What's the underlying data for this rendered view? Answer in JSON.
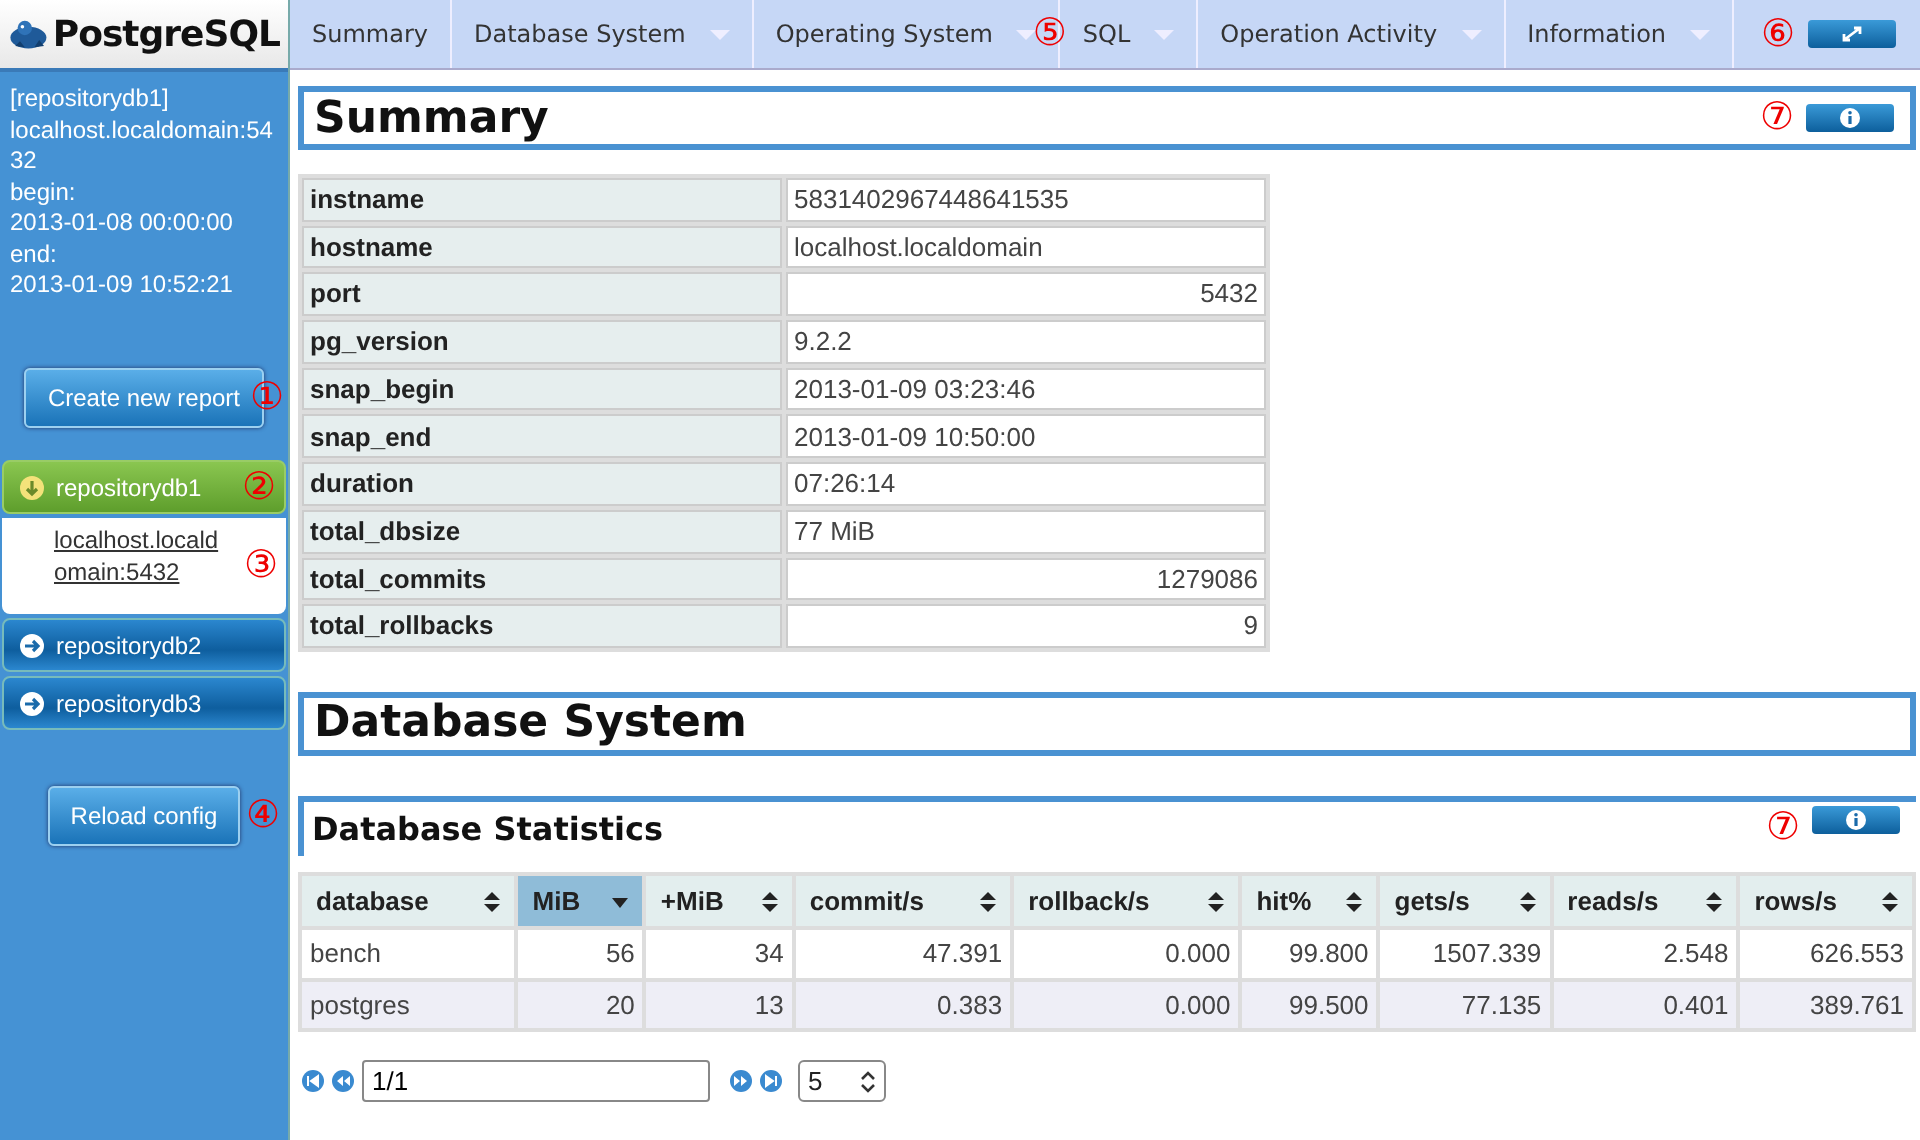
{
  "logo": {
    "text": "PostgreSQL"
  },
  "sidebar": {
    "info_lines": [
      "[repositorydb1]",
      "localhost.localdomain:5432",
      "begin:",
      "2013-01-08 00:00:00",
      "end:",
      "2013-01-09 10:52:21"
    ],
    "create_button": {
      "label": "Create new report",
      "callout": "①"
    },
    "repositories": [
      {
        "name": "repositorydb1",
        "expanded": true,
        "callout": "②",
        "children": [
          {
            "label": "localhost.localdomain:5432",
            "callout": "③"
          }
        ]
      },
      {
        "name": "repositorydb2",
        "expanded": false
      },
      {
        "name": "repositorydb3",
        "expanded": false
      }
    ],
    "reload_button": {
      "label": "Reload config",
      "callout": "④"
    }
  },
  "menu": {
    "items": [
      {
        "label": "Summary",
        "dropdown": false
      },
      {
        "label": "Database System",
        "dropdown": true
      },
      {
        "label": "Operating System",
        "dropdown": true,
        "callout": "⑤"
      },
      {
        "label": "SQL",
        "dropdown": true
      },
      {
        "label": "Operation Activity",
        "dropdown": true
      },
      {
        "label": "Information",
        "dropdown": true
      }
    ],
    "expand_callout": "⑥"
  },
  "sections": [
    {
      "kind": "header",
      "title": "Summary",
      "info_callout": "⑦"
    },
    {
      "kind": "keyvalue",
      "rows": [
        {
          "key": "instname",
          "value": "5831402967448641535",
          "kind": "text"
        },
        {
          "key": "hostname",
          "value": "localhost.localdomain",
          "kind": "text"
        },
        {
          "key": "port",
          "value": "5432",
          "kind": "number"
        },
        {
          "key": "pg_version",
          "value": "9.2.2",
          "kind": "text"
        },
        {
          "key": "snap_begin",
          "value": "2013-01-09 03:23:46",
          "kind": "text"
        },
        {
          "key": "snap_end",
          "value": "2013-01-09 10:50:00",
          "kind": "text"
        },
        {
          "key": "duration",
          "value": "07:26:14",
          "kind": "text"
        },
        {
          "key": "total_dbsize",
          "value": "77 MiB",
          "kind": "text"
        },
        {
          "key": "total_commits",
          "value": "1279086",
          "kind": "number"
        },
        {
          "key": "total_rollbacks",
          "value": "9",
          "kind": "number"
        }
      ]
    },
    {
      "kind": "header",
      "title": "Database System"
    },
    {
      "kind": "subheader",
      "title": "Database Statistics",
      "info_callout": "⑦"
    },
    {
      "kind": "grid",
      "columns": [
        {
          "label": "database",
          "sorted": false
        },
        {
          "label": "MiB",
          "sorted": true
        },
        {
          "label": "+MiB",
          "sorted": false
        },
        {
          "label": "commit/s",
          "sorted": false
        },
        {
          "label": "rollback/s",
          "sorted": false
        },
        {
          "label": "hit%",
          "sorted": false
        },
        {
          "label": "gets/s",
          "sorted": false
        },
        {
          "label": "reads/s",
          "sorted": false
        },
        {
          "label": "rows/s",
          "sorted": false
        }
      ],
      "rows": [
        [
          "bench",
          "56",
          "34",
          "47.391",
          "0.000",
          "99.800",
          "1507.339",
          "2.548",
          "626.553"
        ],
        [
          "postgres",
          "20",
          "13",
          "0.383",
          "0.000",
          "99.500",
          "77.135",
          "0.401",
          "389.761"
        ]
      ],
      "pager": {
        "page": "1/1",
        "page_size": "5"
      }
    }
  ]
}
